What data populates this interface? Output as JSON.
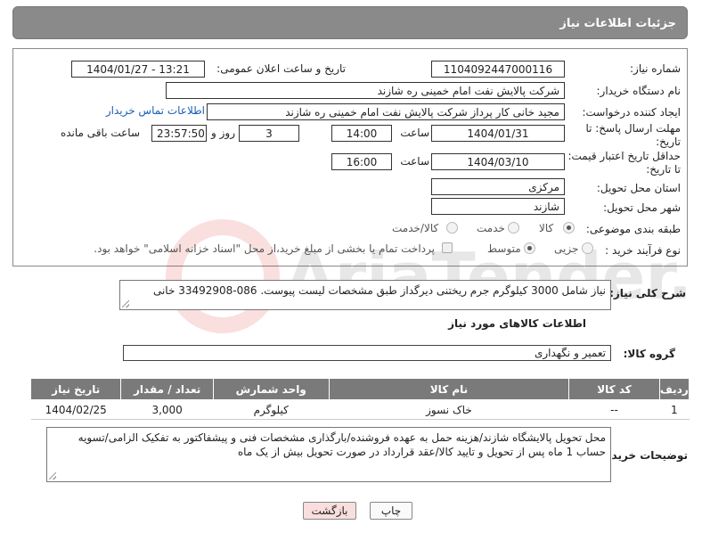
{
  "header": {
    "title": "جزئیات اطلاعات نیاز"
  },
  "form": {
    "need_number_label": "شماره نیاز:",
    "need_number": "1104092447000116",
    "announce_label": "تاریخ و ساعت اعلان عمومی:",
    "announce_value": "1404/01/27 - 13:21",
    "buyer_label": "نام دستگاه خریدار:",
    "buyer_value": "شرکت پالایش نفت امام خمینی  ره  شازند",
    "creator_label": "ایجاد کننده درخواست:",
    "creator_value": "مجید خانی کار پرداز شرکت پالایش نفت امام خمینی  ره  شازند",
    "contact_link": "اطلاعات تماس خریدار",
    "deadline_label_1": "مهلت ارسال پاسخ: تا",
    "deadline_label_2": "تاریخ:",
    "deadline_date": "1404/01/31",
    "time_label": "ساعت",
    "deadline_time": "14:00",
    "days_value": "3",
    "days_label": "روز و",
    "remaining_time": "23:57:50",
    "remaining_label": "ساعت باقی مانده",
    "validity_label_1": "حداقل تاریخ اعتبار قیمت:",
    "validity_label_2": "تا تاریخ:",
    "validity_date": "1404/03/10",
    "validity_time": "16:00",
    "province_label": "استان محل تحویل:",
    "province_value": "مرکزی",
    "city_label": "شهر محل تحویل:",
    "city_value": "شازند",
    "category_label": "طبقه بندی موضوعی:",
    "category_options": [
      "کالا",
      "خدمت",
      "کالا/خدمت"
    ],
    "process_label": "نوع فرآیند خرید :",
    "process_options": [
      "جزیی",
      "متوسط"
    ],
    "payment_note": "پرداخت تمام یا بخشی از مبلغ خرید،از محل \"اسناد خزانه اسلامی\" خواهد بود."
  },
  "description": {
    "label": "شرح کلی نیاز:",
    "text": "نیاز شامل 3000 کیلوگرم جرم ریختنی دیرگداز طبق مشخصات لیست پیوست. 086-33492908 خانی"
  },
  "goods": {
    "section_title": "اطلاعات کالاهای مورد نیاز",
    "group_label": "گروه کالا:",
    "group_value": "تعمیر و نگهداری",
    "columns": [
      "ردیف",
      "کد کالا",
      "نام کالا",
      "واحد شمارش",
      "تعداد / مقدار",
      "تاریخ نیاز"
    ],
    "rows": [
      [
        "1",
        "--",
        "خاک نسوز",
        "کیلوگرم",
        "3,000",
        "1404/02/25"
      ]
    ]
  },
  "notes": {
    "label": "توضیحات خریدار:",
    "text": "محل تحویل پالایشگاه شازند/هزینه حمل به عهده فروشنده/بارگذاری مشخصات فنی و پیشفاکتور به تفکیک الزامی/تسویه حساب 1 ماه پس از تحویل و تایید کالا/عقد قرارداد در صورت تحویل بیش از یک ماه"
  },
  "buttons": {
    "print": "چاپ",
    "back": "بازگشت"
  },
  "watermark": {
    "text": "AriaTender.net"
  },
  "colors": {
    "header_bg": "#8a8a8a",
    "table_header_bg": "#7a7a7a",
    "link": "#1a5fb4",
    "back_button_bg": "#f9dede"
  }
}
